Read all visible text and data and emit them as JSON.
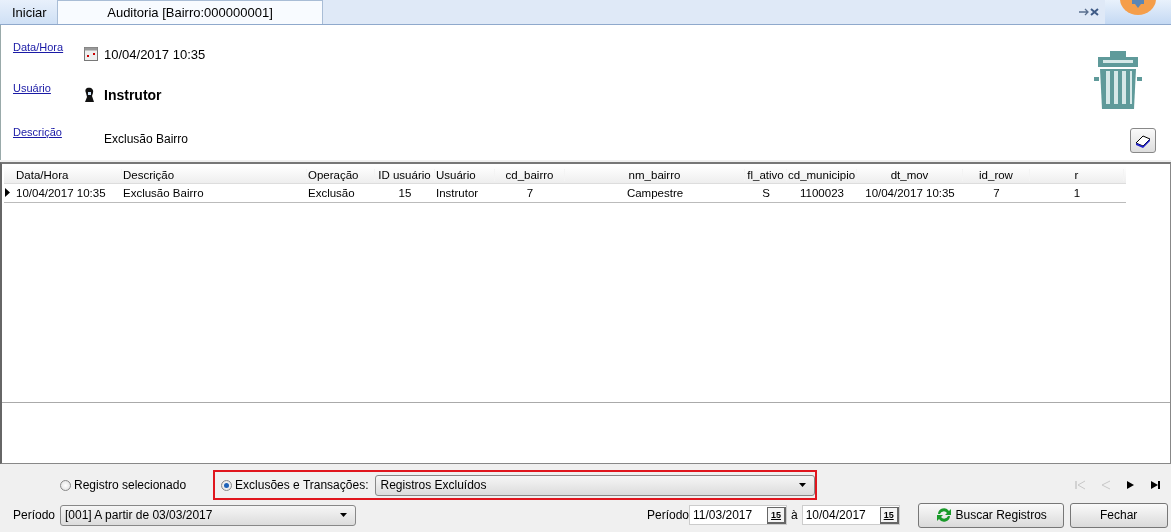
{
  "tabs": [
    {
      "label": "Iniciar",
      "selected": false
    },
    {
      "label": "Auditoria [Bairro:000000001]",
      "selected": true
    }
  ],
  "details": [
    {
      "label": "Data/Hora",
      "value": "10/04/2017 10:35",
      "kind": "date"
    },
    {
      "label": "Usuário",
      "value": "Instrutor",
      "kind": "user"
    },
    {
      "label": "Descrição",
      "value": "Exclusão Bairro",
      "kind": "text"
    }
  ],
  "table": {
    "columns": [
      "Data/Hora",
      "Descrição",
      "Operação",
      "ID usuário",
      "Usuário",
      "cd_bairro",
      "nm_bairro",
      "fl_ativo",
      "cd_municipio",
      "dt_mov",
      "id_row",
      "r"
    ],
    "rows": [
      {
        "selected": true,
        "cells": [
          "10/04/2017 10:35",
          "Exclusão Bairro",
          "Exclusão",
          "15",
          "Instrutor",
          "7",
          "Campestre",
          "S",
          "1100023",
          "10/04/2017 10:35",
          "7",
          "1"
        ]
      }
    ]
  },
  "filters": {
    "radios": [
      {
        "label": "Registro selecionado",
        "selected": false
      },
      {
        "label": "Exclusões e Transações:",
        "selected": true
      }
    ],
    "mode_select": {
      "value": "Registros Excluídos"
    },
    "period": {
      "label": "Período",
      "value": "[001] A partir de 03/03/2017"
    },
    "range": {
      "label": "Período",
      "from": "11/03/2017",
      "from_picker": "15",
      "separator": "à",
      "to": "10/04/2017",
      "to_picker": "15"
    },
    "nav": [
      {
        "kind": "first",
        "disabled": true
      },
      {
        "kind": "prev",
        "disabled": true
      },
      {
        "kind": "next",
        "disabled": false
      },
      {
        "kind": "last",
        "disabled": false
      }
    ],
    "buttons": [
      {
        "label": "Buscar Registros",
        "kind": "refresh"
      },
      {
        "label": "Fechar",
        "kind": "plain"
      }
    ]
  }
}
